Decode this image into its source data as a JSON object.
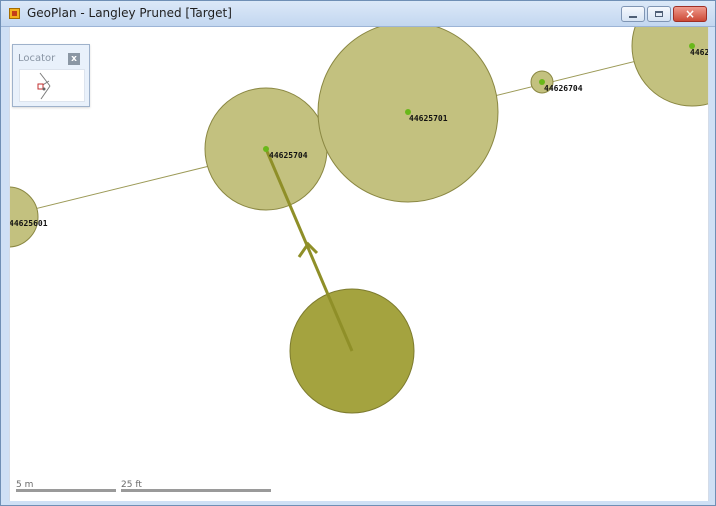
{
  "window": {
    "title": "GeoPlan - Langley Pruned [Target]",
    "close_symbol": "×"
  },
  "locator": {
    "title": "Locator",
    "close_symbol": "x"
  },
  "map": {
    "nodes": [
      {
        "id": "44625601"
      },
      {
        "id": "44625704"
      },
      {
        "id": "44625701"
      },
      {
        "id": "44626704"
      },
      {
        "id": "4462"
      }
    ]
  },
  "scale": {
    "meters_label": "5 m",
    "feet_label": "25 ft"
  },
  "colors": {
    "circle_fill": "#c3c17f",
    "circle_stroke": "#8a8742",
    "selected_fill": "#a4a33f",
    "line_color": "#9c9a57",
    "node_color": "#69b81a"
  },
  "icons": {
    "app": "map-app-icon",
    "minimize": "minimize-icon",
    "maximize": "maximize-icon",
    "close": "close-icon",
    "locator": "locator-map-icon",
    "arrow": "arrow-head-icon"
  }
}
